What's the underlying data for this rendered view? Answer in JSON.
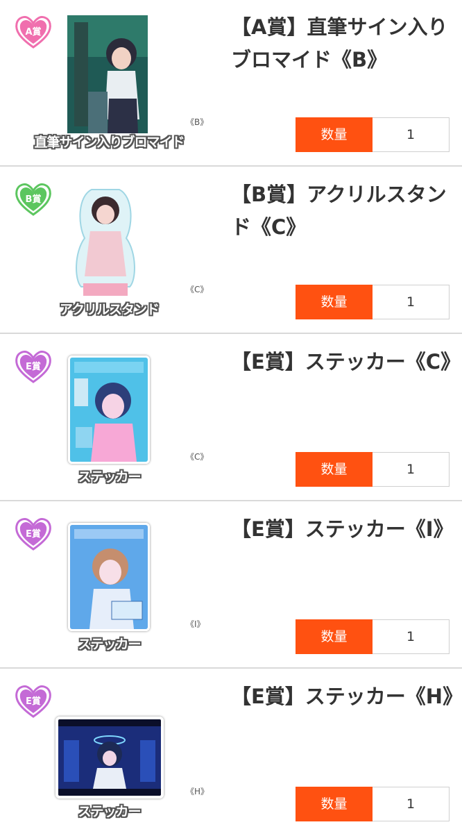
{
  "items": [
    {
      "badge_text": "A賞",
      "badge_color": "#f06fae",
      "caption": "直筆サイン入りブロマイド",
      "variant": "《B》",
      "title": "【A賞】直筆サイン入りブロマイド《B》",
      "quantity_label": "数量",
      "quantity_value": "1"
    },
    {
      "badge_text": "B賞",
      "badge_color": "#5cc65f",
      "caption": "アクリルスタンド",
      "variant": "《C》",
      "title": "【B賞】アクリルスタンド《C》",
      "quantity_label": "数量",
      "quantity_value": "1"
    },
    {
      "badge_text": "E賞",
      "badge_color": "#c46ad6",
      "caption": "ステッカー",
      "variant": "《C》",
      "title": "【E賞】ステッカー《C》",
      "quantity_label": "数量",
      "quantity_value": "1"
    },
    {
      "badge_text": "E賞",
      "badge_color": "#c46ad6",
      "caption": "ステッカー",
      "variant": "《I》",
      "title": "【E賞】ステッカー《I》",
      "quantity_label": "数量",
      "quantity_value": "1"
    },
    {
      "badge_text": "E賞",
      "badge_color": "#c46ad6",
      "caption": "ステッカー",
      "variant": "《H》",
      "title": "【E賞】ステッカー《H》",
      "quantity_label": "数量",
      "quantity_value": "1"
    }
  ],
  "colors": {
    "accent": "#ff5111",
    "divider": "#d9d9d9",
    "title": "#333333"
  }
}
